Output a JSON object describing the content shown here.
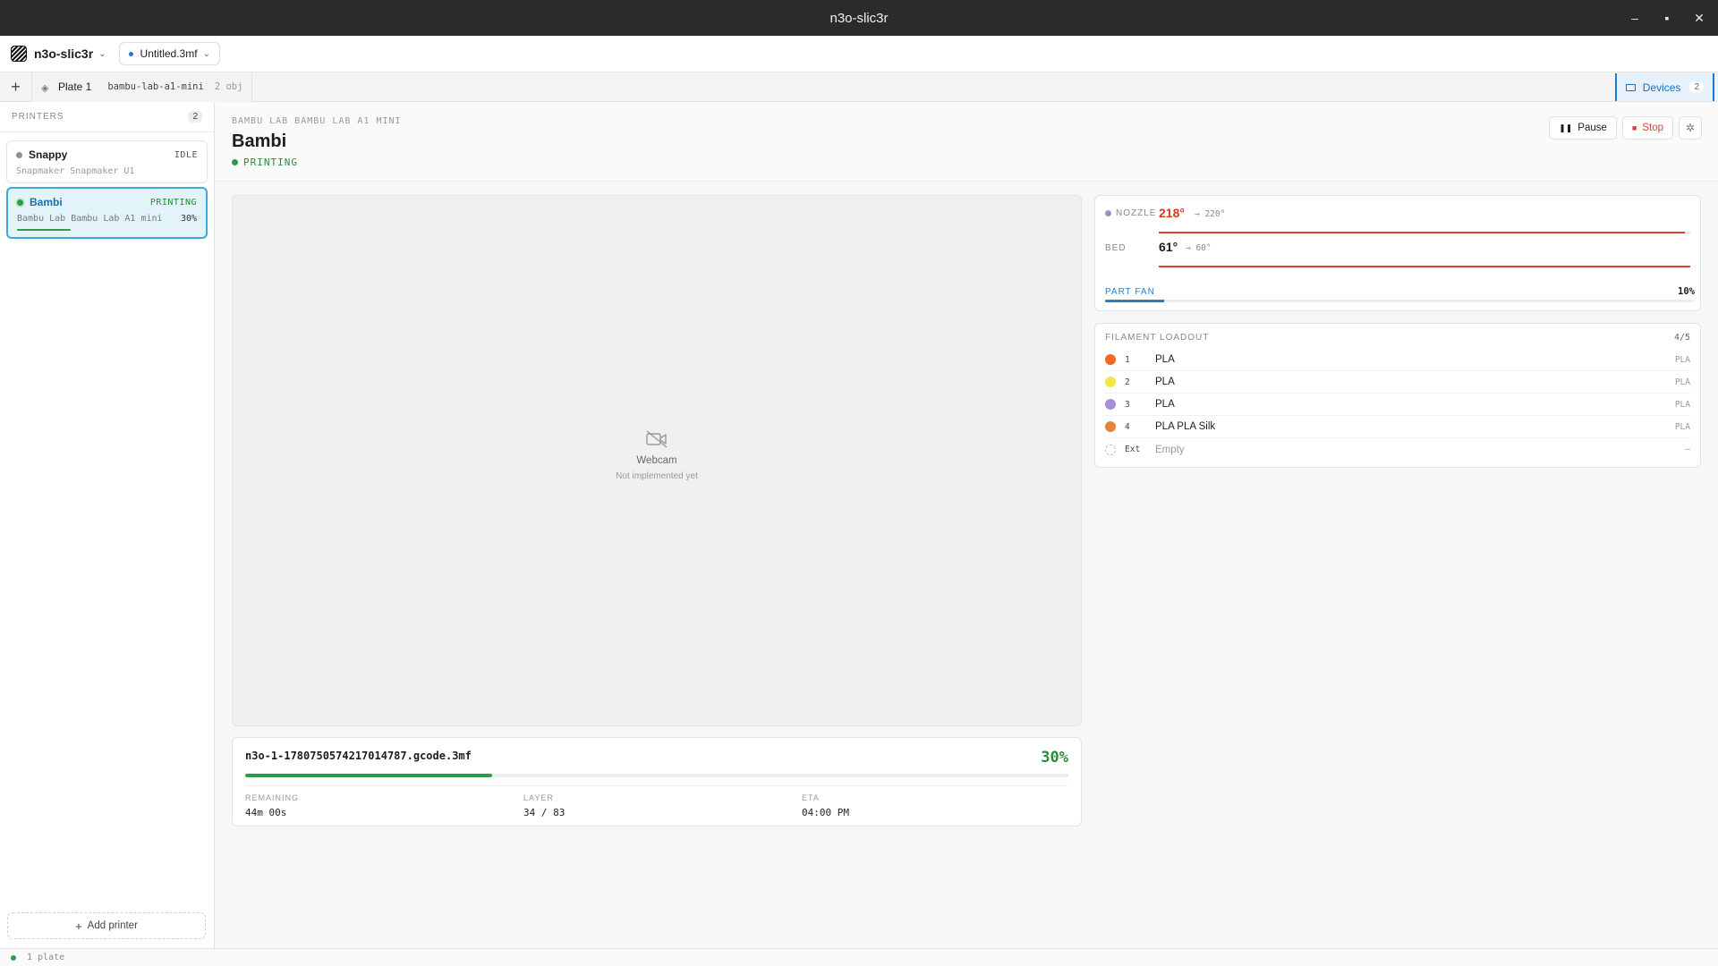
{
  "window": {
    "title": "n3o-slic3r"
  },
  "app": {
    "name": "n3o-slic3r",
    "file": "Untitled.3mf"
  },
  "plate": {
    "name": "Plate 1",
    "profile": "bambu-lab-a1-mini",
    "objects": "2 obj"
  },
  "devices_tab": {
    "label": "Devices",
    "count": "2"
  },
  "sidebar": {
    "heading": "PRINTERS",
    "count": "2",
    "printers": [
      {
        "name": "Snappy",
        "status": "IDLE",
        "model": "Snapmaker Snapmaker U1",
        "status_color": "#8f8f95"
      },
      {
        "name": "Bambi",
        "status": "PRINTING",
        "model": "Bambu Lab Bambu Lab A1 mini",
        "progress": "30%",
        "status_color": "#2e9c45"
      }
    ],
    "add_label": "Add printer"
  },
  "detail": {
    "subtitle": "BAMBU LAB BAMBU LAB A1 MINI",
    "title": "Bambi",
    "status": "PRINTING",
    "pause_label": "Pause",
    "stop_label": "Stop",
    "webcam_title": "Webcam",
    "webcam_sub": "Not implemented yet"
  },
  "job": {
    "filename": "n3o-1-1780750574217014787.gcode.3mf",
    "percent": "30%",
    "progress": 0.3,
    "remaining_label": "REMAINING",
    "remaining": "44m 00s",
    "layer_label": "LAYER",
    "layer": "34 / 83",
    "eta_label": "ETA",
    "eta": "04:00 PM"
  },
  "temps": {
    "nozzle_label": "NOZZLE",
    "nozzle": "218°",
    "nozzle_target": "→ 220°",
    "nozzle_fill": 0.99,
    "bed_label": "BED",
    "bed": "61°",
    "bed_target": "→ 60°",
    "bed_fill": 1.0,
    "fan_label": "PART FAN",
    "fan": "10%",
    "fan_fill": 0.1
  },
  "filament": {
    "heading": "FILAMENT LOADOUT",
    "count": "4/5",
    "slots": [
      {
        "slot": "1",
        "name": "PLA",
        "type": "PLA",
        "color": "#f26a21"
      },
      {
        "slot": "2",
        "name": "PLA",
        "type": "PLA",
        "color": "#f3e64a"
      },
      {
        "slot": "3",
        "name": "PLA",
        "type": "PLA",
        "color": "#a98fd8"
      },
      {
        "slot": "4",
        "name": "PLA PLA Silk",
        "type": "PLA",
        "color": "#e8843a"
      },
      {
        "slot": "Ext",
        "name": "Empty",
        "type": "—",
        "color": ""
      }
    ]
  },
  "statusbar": {
    "text": "1 plate"
  }
}
